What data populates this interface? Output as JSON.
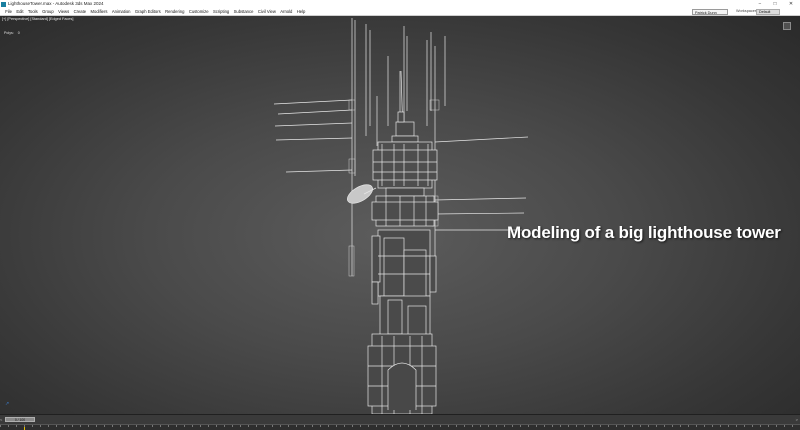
{
  "window": {
    "title": "LighthouseTower.max - Autodesk 3ds Max 2024",
    "controls": [
      "−",
      "□",
      "✕"
    ]
  },
  "menu": {
    "items": [
      "File",
      "Edit",
      "Tools",
      "Group",
      "Views",
      "Create",
      "Modifiers",
      "Animation",
      "Graph Editors",
      "Rendering",
      "Customize",
      "Scripting",
      "Substance",
      "Civil View",
      "Arnold",
      "Help"
    ],
    "signin_label": "Patrick Dunn",
    "workspace_label": "Workspaces:",
    "workspace_value": "Default"
  },
  "viewport": {
    "label": "[+] [Perspective] [Standard] [Edged Faces]",
    "stats_label": "Polys:",
    "stats_value": "0"
  },
  "caption": "Modeling of a big lighthouse tower",
  "timeline": {
    "slider_label": "0 / 100",
    "left_arrow": "<",
    "right_arrow": ">"
  },
  "colors": {
    "viewport_center": "#5c5c5c",
    "viewport_edge": "#2a2a2a",
    "wire": "#e8e8e8",
    "caption": "#ffffff",
    "key_marker": "#e6c100"
  }
}
